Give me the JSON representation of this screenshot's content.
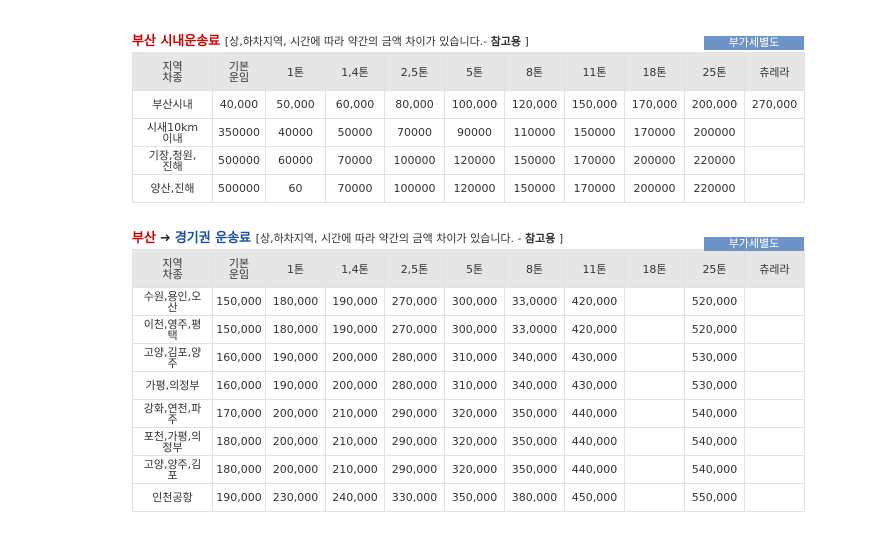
{
  "section1": {
    "title_city": "부산 시내운송료",
    "note_prefix": "[상,하차지역, 시간에 따라 약간의 금액 차이가 있습니다.- ",
    "note_bold": "참고용",
    "note_suffix": " ]",
    "vat_label": "부가세별도",
    "headers": [
      "지역\n차종",
      "기본\n운임",
      "1톤",
      "1,4톤",
      "2,5톤",
      "5톤",
      "8톤",
      "11톤",
      "18톤",
      "25톤",
      "츄레라"
    ],
    "rows": [
      [
        "부산시내",
        "40,000",
        "50,000",
        "60,000",
        "80,000",
        "100,000",
        "120,000",
        "150,000",
        "170,000",
        "200,000",
        "270,000"
      ],
      [
        "시새10km\n이내",
        "350000",
        "40000",
        "50000",
        "70000",
        "90000",
        "110000",
        "150000",
        "170000",
        "200000",
        ""
      ],
      [
        "기장,청원,\n진해",
        "500000",
        "60000",
        "70000",
        "100000",
        "120000",
        "150000",
        "170000",
        "200000",
        "220000",
        ""
      ],
      [
        "양산,진해",
        "500000",
        "60",
        "70000",
        "100000",
        "120000",
        "150000",
        "170000",
        "200000",
        "220000",
        ""
      ]
    ]
  },
  "section2": {
    "title_from": "부산",
    "arrow": "➜",
    "title_to": "경기권 운송료",
    "note_prefix": "[상,하차지역, 시간에 따라 약간의 금액 차이가 있습니다. - ",
    "note_bold": "참고용",
    "note_suffix": " ]",
    "vat_label": "부가세별도",
    "headers": [
      "지역\n차종",
      "기본\n운임",
      "1톤",
      "1,4톤",
      "2,5톤",
      "5톤",
      "8톤",
      "11톤",
      "18톤",
      "25톤",
      "츄레라"
    ],
    "rows": [
      [
        "수원,용인,오\n산",
        "150,000",
        "180,000",
        "190,000",
        "270,000",
        "300,000",
        "33,0000",
        "420,000",
        "",
        "520,000",
        ""
      ],
      [
        "이천,영주,평\n택",
        "150,000",
        "180,000",
        "190,000",
        "270,000",
        "300,000",
        "33,0000",
        "420,000",
        "",
        "520,000",
        ""
      ],
      [
        "고양,김포,양\n주",
        "160,000",
        "190,000",
        "200,000",
        "280,000",
        "310,000",
        "340,000",
        "430,000",
        "",
        "530,000",
        ""
      ],
      [
        "가평,의정부",
        "160,000",
        "190,000",
        "200,000",
        "280,000",
        "310,000",
        "340,000",
        "430,000",
        "",
        "530,000",
        ""
      ],
      [
        "강화,연천,파\n주",
        "170,000",
        "200,000",
        "210,000",
        "290,000",
        "320,000",
        "350,000",
        "440,000",
        "",
        "540,000",
        ""
      ],
      [
        "포천,가평,의\n정부",
        "180,000",
        "200,000",
        "210,000",
        "290,000",
        "320,000",
        "350,000",
        "440,000",
        "",
        "540,000",
        ""
      ],
      [
        "고양,양주,김\n포",
        "180,000",
        "200,000",
        "210,000",
        "290,000",
        "320,000",
        "350,000",
        "440,000",
        "",
        "540,000",
        ""
      ],
      [
        "인천공항",
        "190,000",
        "230,000",
        "240,000",
        "330,000",
        "350,000",
        "380,000",
        "450,000",
        "",
        "550,000",
        ""
      ]
    ]
  }
}
